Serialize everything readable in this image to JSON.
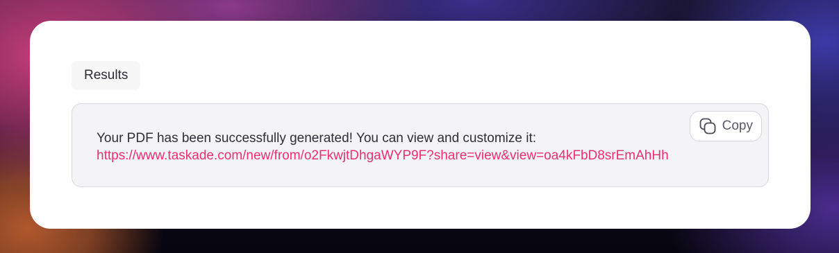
{
  "panel": {
    "tab_label": "Results"
  },
  "result": {
    "message": "Your PDF has been successfully generated! You can view and customize it:",
    "link": "https://www.taskade.com/new/from/o2FkwjtDhgaWYP9F?share=view&view=oa4kFbD8srEmAhHh"
  },
  "copy_button": {
    "label": "Copy",
    "icon": "copy-icon"
  },
  "colors": {
    "link": "#e8306e",
    "card_background": "#ffffff",
    "result_background": "#f4f3f6"
  }
}
